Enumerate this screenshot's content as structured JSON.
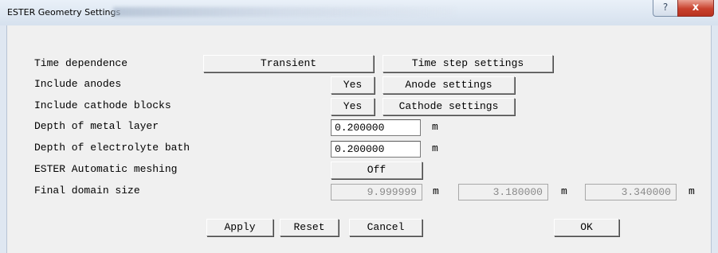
{
  "window": {
    "title": "ESTER Geometry Settings",
    "help_glyph": "?",
    "close_glyph": "x"
  },
  "rows": {
    "time_dependence": {
      "label": "Time dependence",
      "value": "Transient",
      "settings_button": "Time step settings"
    },
    "include_anodes": {
      "label": "Include anodes",
      "value": "Yes",
      "settings_button": "Anode settings"
    },
    "include_cathode_blocks": {
      "label": "Include cathode blocks",
      "value": "Yes",
      "settings_button": "Cathode settings"
    },
    "metal_depth": {
      "label": "Depth of metal layer",
      "value": "0.200000",
      "unit": "m"
    },
    "bath_depth": {
      "label": "Depth of electrolyte bath",
      "value": "0.200000",
      "unit": "m"
    },
    "auto_meshing": {
      "label": "ESTER Automatic meshing",
      "value": "Off"
    },
    "domain_size": {
      "label": "Final domain size",
      "x": "9.999999",
      "y": "3.180000",
      "z": "3.340000",
      "unit": "m"
    }
  },
  "actions": {
    "apply": "Apply",
    "reset": "Reset",
    "cancel": "Cancel",
    "ok": "OK"
  }
}
